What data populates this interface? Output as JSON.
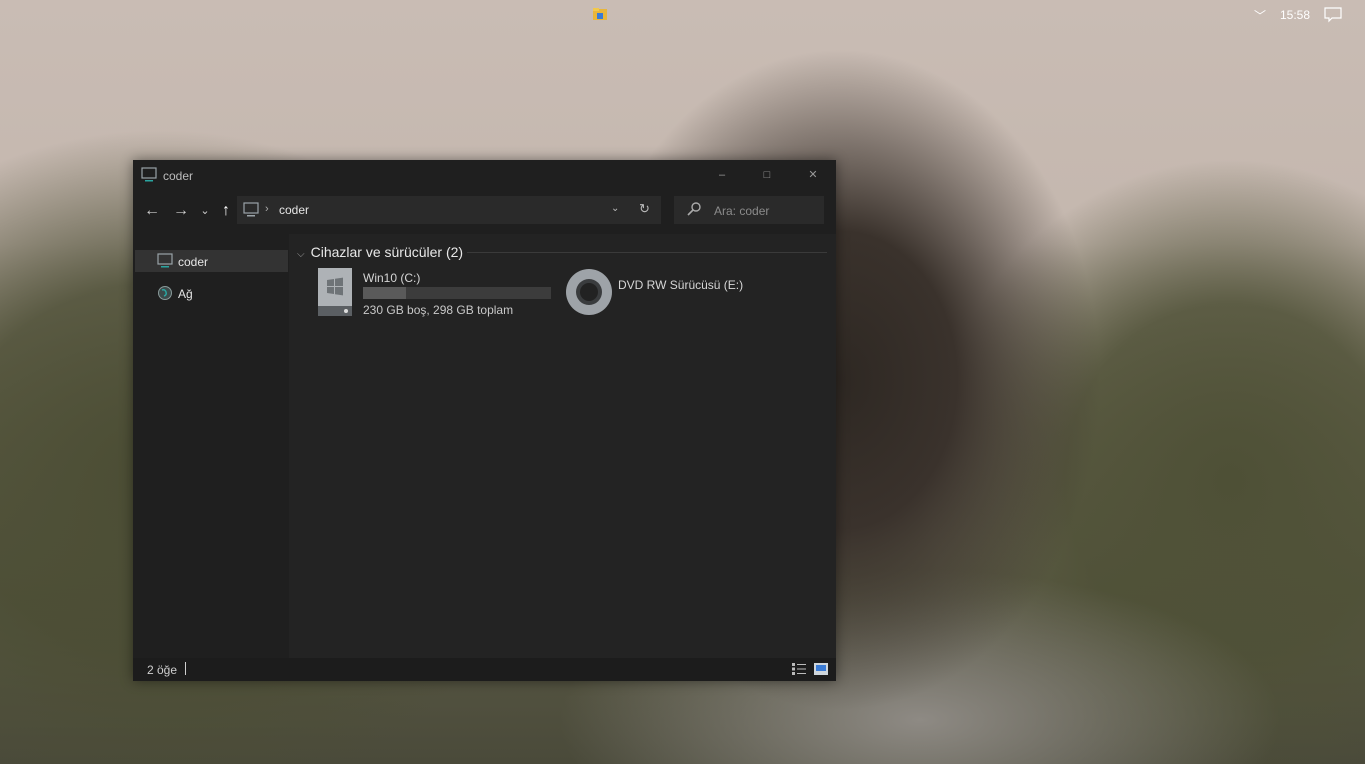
{
  "desktop": {
    "clock": "15:58"
  },
  "window": {
    "title": "coder",
    "controls": {
      "minimize": "–",
      "maximize": "□",
      "close": "✕"
    }
  },
  "nav": {
    "back": "←",
    "forward": "→",
    "recent": "⌄",
    "up": "↑",
    "address_sep": "›",
    "address_crumb": "coder",
    "address_drop": "⌄",
    "refresh": "↻",
    "search_placeholder": "Ara: coder"
  },
  "sidebar": {
    "items": [
      {
        "label": "coder",
        "icon": "computer-icon"
      },
      {
        "label": "Ağ",
        "icon": "network-icon"
      }
    ]
  },
  "content": {
    "group_chevron": "⌵",
    "group_title": "Cihazlar ve sürücüler (2)",
    "drives": [
      {
        "name": "Win10 (C:)",
        "size": "230 GB boş, 298 GB toplam",
        "used_fraction": 0.23,
        "icon": "hard-drive-windows-icon"
      },
      {
        "name": "DVD RW Sürücüsü (E:)",
        "icon": "dvd-drive-icon"
      }
    ]
  },
  "status": {
    "count": "2 öğe"
  },
  "colors": {
    "window_bg": "#1f1f1f",
    "content_bg": "#232323",
    "accent": "#2aa5a0"
  }
}
